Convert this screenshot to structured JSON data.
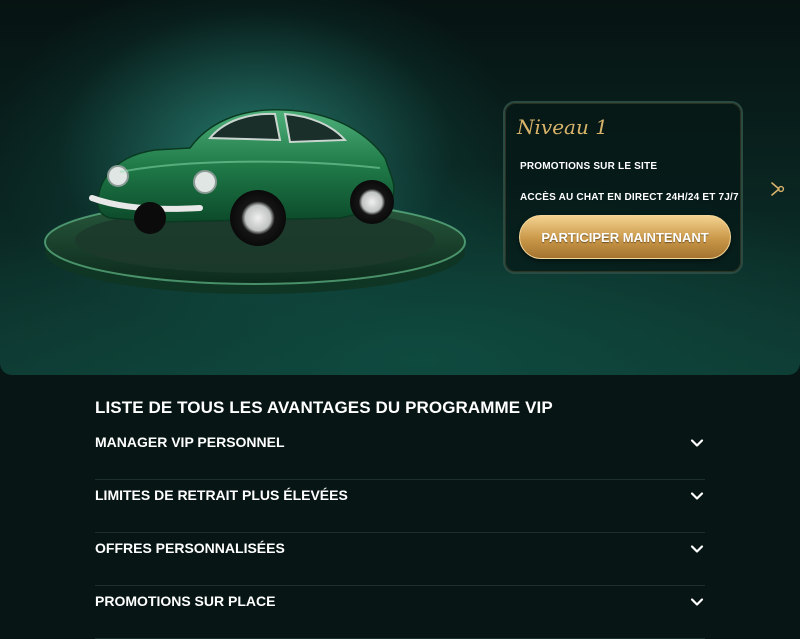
{
  "hero": {
    "level_title": "Niveau 1",
    "perks": [
      "PROMOTIONS SUR LE SITE",
      "ACCÈS AU CHAT EN DIRECT 24H/24 ET 7J/7"
    ],
    "cta_label": "PARTICIPER MAINTENANT",
    "next_icon": "chevron-right-icon",
    "image": "green-vintage-sports-car-on-turntable"
  },
  "benefits": {
    "title": "LISTE DE TOUS LES AVANTAGES DU PROGRAMME VIP",
    "items": [
      {
        "label": "MANAGER VIP PERSONNEL"
      },
      {
        "label": "LIMITES DE RETRAIT PLUS ÉLEVÉES"
      },
      {
        "label": "OFFRES PERSONNALISÉES"
      },
      {
        "label": "PROMOTIONS SUR PLACE"
      }
    ],
    "expand_icon": "chevron-down-icon"
  },
  "colors": {
    "background": "#071614",
    "accent_gold": "#d7b36a",
    "card_border": "#2b4a42"
  }
}
